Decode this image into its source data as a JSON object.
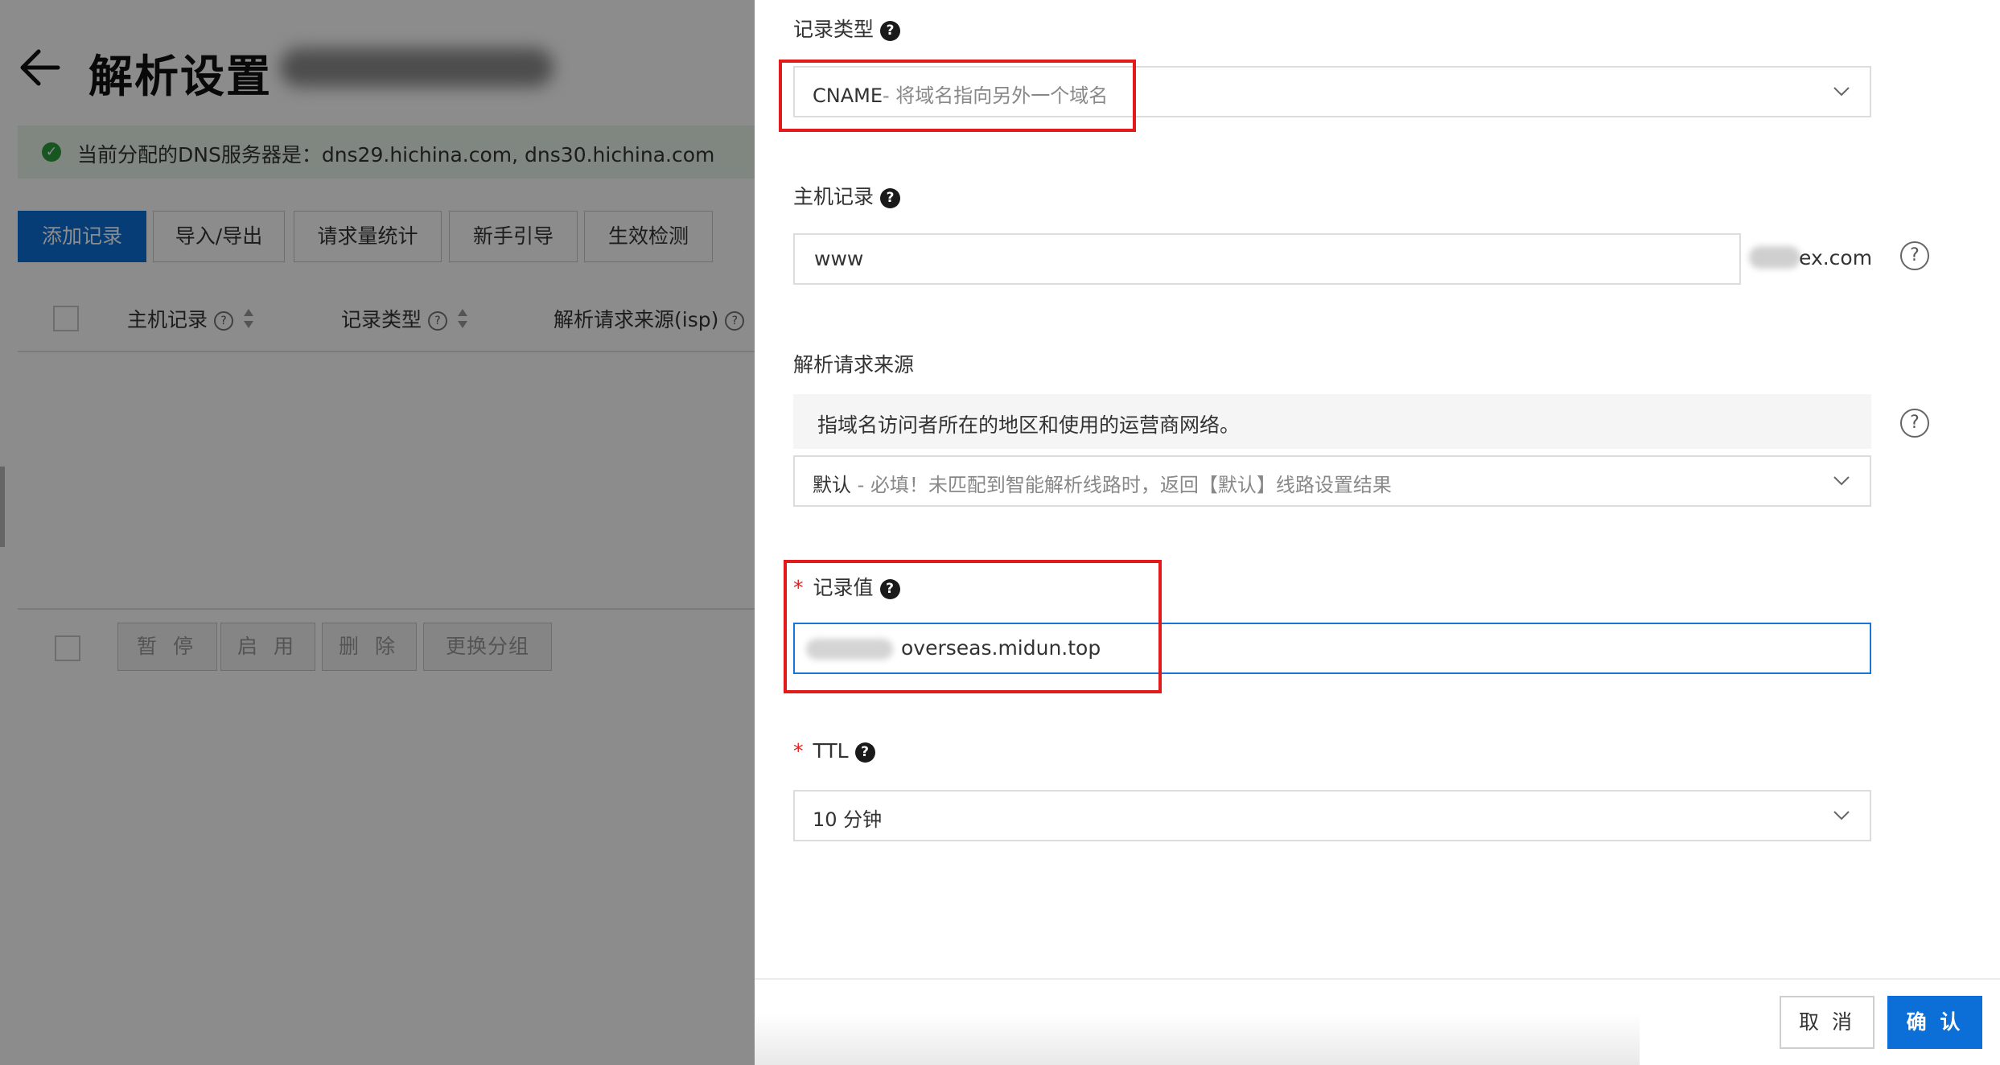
{
  "background": {
    "page_title": "解析设置",
    "dns_notice": "当前分配的DNS服务器是：dns29.hichina.com, dns30.hichina.com",
    "toolbar": [
      "添加记录",
      "导入/导出",
      "请求量统计",
      "新手引导",
      "生效检测"
    ],
    "table_headers": [
      "主机记录",
      "记录类型",
      "解析请求来源(isp)"
    ],
    "footer_buttons": [
      "暂 停",
      "启 用",
      "删 除",
      "更换分组"
    ]
  },
  "drawer": {
    "record_type": {
      "label": "记录类型",
      "help_icon": "question-icon",
      "value_code": "CNAME",
      "value_desc": "- 将域名指向另外一个域名"
    },
    "host_record": {
      "label": "主机记录",
      "help_icon": "question-icon",
      "value": "www",
      "domain_suffix_visible": "ex.com"
    },
    "request_source": {
      "label": "解析请求来源",
      "hint": "指域名访问者所在的地区和使用的运营商网络。",
      "value_main": "默认",
      "value_desc": " - 必填！未匹配到智能解析线路时，返回【默认】线路设置结果"
    },
    "record_value": {
      "label": "记录值",
      "required": "*",
      "help_icon": "question-icon",
      "value_visible": "overseas.midun.top"
    },
    "ttl": {
      "label": "TTL",
      "required": "*",
      "help_icon": "question-icon",
      "value": "10 分钟"
    },
    "buttons": {
      "cancel": "取 消",
      "confirm": "确 认"
    }
  },
  "colors": {
    "primary": "#0c6fd8",
    "highlight": "#e31a1a",
    "required": "#e02020",
    "success": "#2a9d3c",
    "focus_border": "#1677d8"
  }
}
